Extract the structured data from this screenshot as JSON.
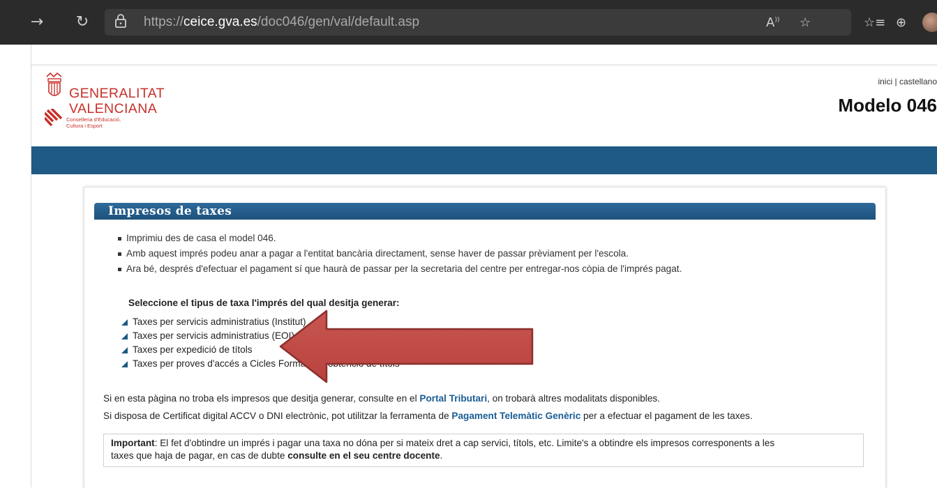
{
  "browser": {
    "url_prefix": "https://",
    "url_host": "ceice.gva.es",
    "url_path": "/doc046/gen/val/default.asp",
    "reader_label": "A",
    "icons": [
      "forward-icon",
      "refresh-icon",
      "lock-icon",
      "read-aloud-icon",
      "favorites-add-icon",
      "favorites-icon",
      "collections-icon",
      "avatar"
    ]
  },
  "header": {
    "logo_line1": "GENERALITAT",
    "logo_line2": "VALENCIANA",
    "logo_sub1": "Conselleria d'Educació,",
    "logo_sub2": "Cultura i Esport",
    "link_home": "inici",
    "link_sep": "|",
    "link_lang": "castellano",
    "title": "Modelo 046"
  },
  "section": {
    "heading": "Impresos de taxes",
    "bullets": [
      "Imprimiu des de casa el model 046.",
      "Amb aquest imprés podeu anar a pagar a l'entitat bancària directament, sense haver de passar prèviament per l'escola.",
      "Ara bé, després d'efectuar el pagament sí que haurà de passar per la secretaria del centre per entregar-nos còpia de l'imprés pagat."
    ],
    "select_prompt": "Seleccione el tipus de taxa l'imprés del qual desitja generar:",
    "options": [
      "Taxes per servicis administratius (Institut)",
      "Taxes per servicis administratius (EOI)",
      "Taxes per expedició de títols",
      "Taxes per proves d'accés a Cicles Formatius i obtenció de títols"
    ],
    "para1_pre": "Si en esta pàgina no troba els impresos que desitja generar, consulte en el ",
    "para1_link": "Portal Tributari",
    "para1_post": ", on trobarà altres modalitats disponibles.",
    "para2_pre": "Si disposa de Certificat digital ACCV o DNI electrònic, pot utilitzar la ferramenta de ",
    "para2_link": "Pagament Telemàtic Genèric",
    "para2_post": " per a efectuar el pagament de les taxes.",
    "important_label": "Important",
    "important_text1": ": El fet d'obtindre un imprés i pagar una taxa no dóna per si mateix dret a cap servici, títols, etc. Limite's a obtindre els impresos corresponents a les",
    "important_text2": "taxes que haja de pagar, en cas de dubte ",
    "important_bold": "consulte en el seu centre docente",
    "important_end": "."
  },
  "colors": {
    "band": "#1e5a84",
    "logo_red": "#c8302a",
    "arrow_fill": "#c0504d",
    "link": "#1a5c94"
  }
}
